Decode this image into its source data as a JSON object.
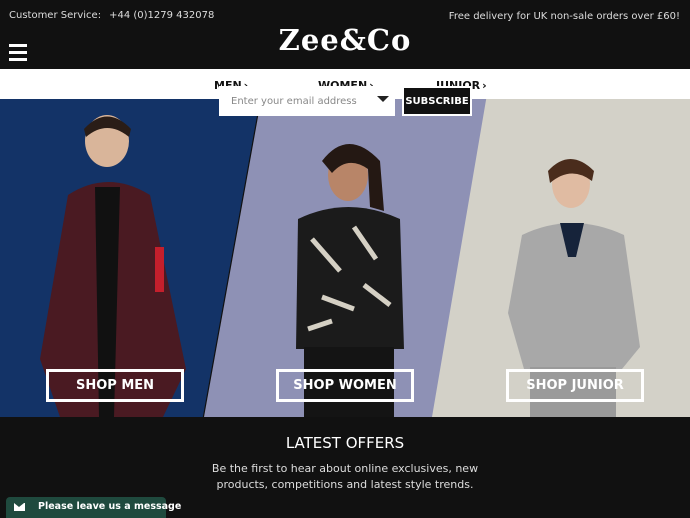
{
  "header": {
    "customer_service_label": "Customer Service:",
    "phone": "+44 (0)1279 432078",
    "delivery_note": "Free delivery for UK non-sale orders over £60!",
    "logo_text": "Zee&Co"
  },
  "nav": {
    "items": [
      {
        "label": "MEN",
        "icon": "chevron-right-icon"
      },
      {
        "label": "WOMEN",
        "icon": "chevron-right-icon"
      },
      {
        "label": "JUNIOR",
        "icon": "chevron-right-icon"
      }
    ]
  },
  "hero": {
    "panels": [
      {
        "button_label": "SHOP MEN",
        "color": "#133367"
      },
      {
        "button_label": "SHOP WOMEN",
        "color": "#8e91b5"
      },
      {
        "button_label": "SHOP JUNIOR",
        "color": "#d3d1c8"
      }
    ]
  },
  "offers": {
    "title": "LATEST OFFERS",
    "text_line1": "Be the first to hear about online exclusives, new",
    "text_line2": "products, competitions and latest style trends.",
    "email_placeholder": "Enter your email address",
    "subscribe_label": "SUBSCRIBE"
  },
  "chat": {
    "label": "Please leave us a message",
    "icon": "envelope-icon"
  },
  "colors": {
    "background": "#111111",
    "chat_green": "#1f4a3e"
  }
}
